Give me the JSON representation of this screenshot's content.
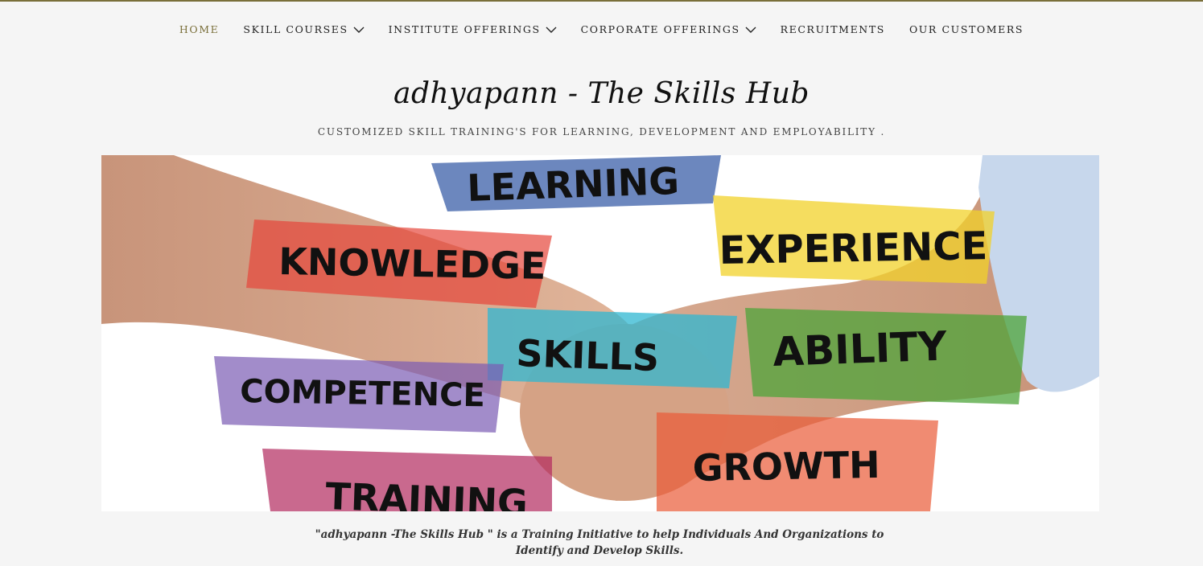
{
  "nav": {
    "items": [
      {
        "label": "HOME",
        "active": true,
        "dropdown": false
      },
      {
        "label": "SKILL COURSES",
        "active": false,
        "dropdown": true
      },
      {
        "label": "INSTITUTE OFFERINGS",
        "active": false,
        "dropdown": true
      },
      {
        "label": "CORPORATE OFFERINGS",
        "active": false,
        "dropdown": true
      },
      {
        "label": "RECRUITMENTS",
        "active": false,
        "dropdown": false
      },
      {
        "label": "OUR CUSTOMERS",
        "active": false,
        "dropdown": false
      }
    ]
  },
  "header": {
    "title": "adhyapann - The Skills Hub",
    "tagline": "CUSTOMIZED SKILL TRAINING'S FOR LEARNING, DEVELOPMENT AND EMPLOYABILITY ."
  },
  "hero": {
    "words": [
      "LEARNING",
      "KNOWLEDGE",
      "EXPERIENCE",
      "SKILLS",
      "ABILITY",
      "COMPETENCE",
      "GROWTH",
      "TRAINING"
    ]
  },
  "intro": {
    "text": "\"adhyapann -The Skills Hub \" is a Training Initiative to help Individuals And Organizations to Identify and Develop Skills."
  },
  "colors": {
    "accent": "#7a6f3a",
    "background": "#f5f5f5",
    "text": "#222222"
  }
}
